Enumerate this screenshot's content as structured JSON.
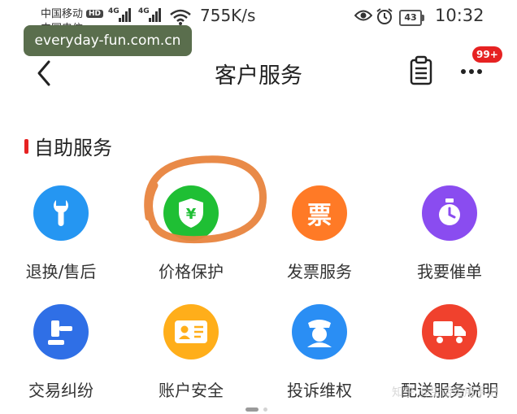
{
  "status_bar": {
    "carrier_primary": "中国移动",
    "hd_badge": "HD",
    "carrier_secondary": "中国电信",
    "signal_1": "4G",
    "signal_2": "4G",
    "net_speed": "755K/s",
    "battery": "43",
    "time": "10:32"
  },
  "watermark": "everyday-fun.com.cn",
  "nav": {
    "title": "客户服务",
    "badge": "99+"
  },
  "section": {
    "title": "自助服务"
  },
  "services": [
    {
      "label": "退换/售后",
      "icon": "wrench-icon",
      "color": "#2596f2"
    },
    {
      "label": "价格保护",
      "icon": "shield-yuan-icon",
      "color": "#1fbf34"
    },
    {
      "label": "发票服务",
      "icon": "ticket-char-icon",
      "color": "#ff7a26",
      "glyph": "票"
    },
    {
      "label": "我要催单",
      "icon": "stopwatch-icon",
      "color": "#8a4cf0"
    },
    {
      "label": "交易纠纷",
      "icon": "gavel-icon",
      "color": "#2f6fe6"
    },
    {
      "label": "账户安全",
      "icon": "id-card-icon",
      "color": "#ffae1a"
    },
    {
      "label": "投诉维权",
      "icon": "police-icon",
      "color": "#2a8ef4"
    },
    {
      "label": "配送服务说明",
      "icon": "truck-icon",
      "color": "#f0412d"
    }
  ],
  "annotation_color": "#e8843e",
  "corner_watermark": "知乎 @生活实用手记"
}
